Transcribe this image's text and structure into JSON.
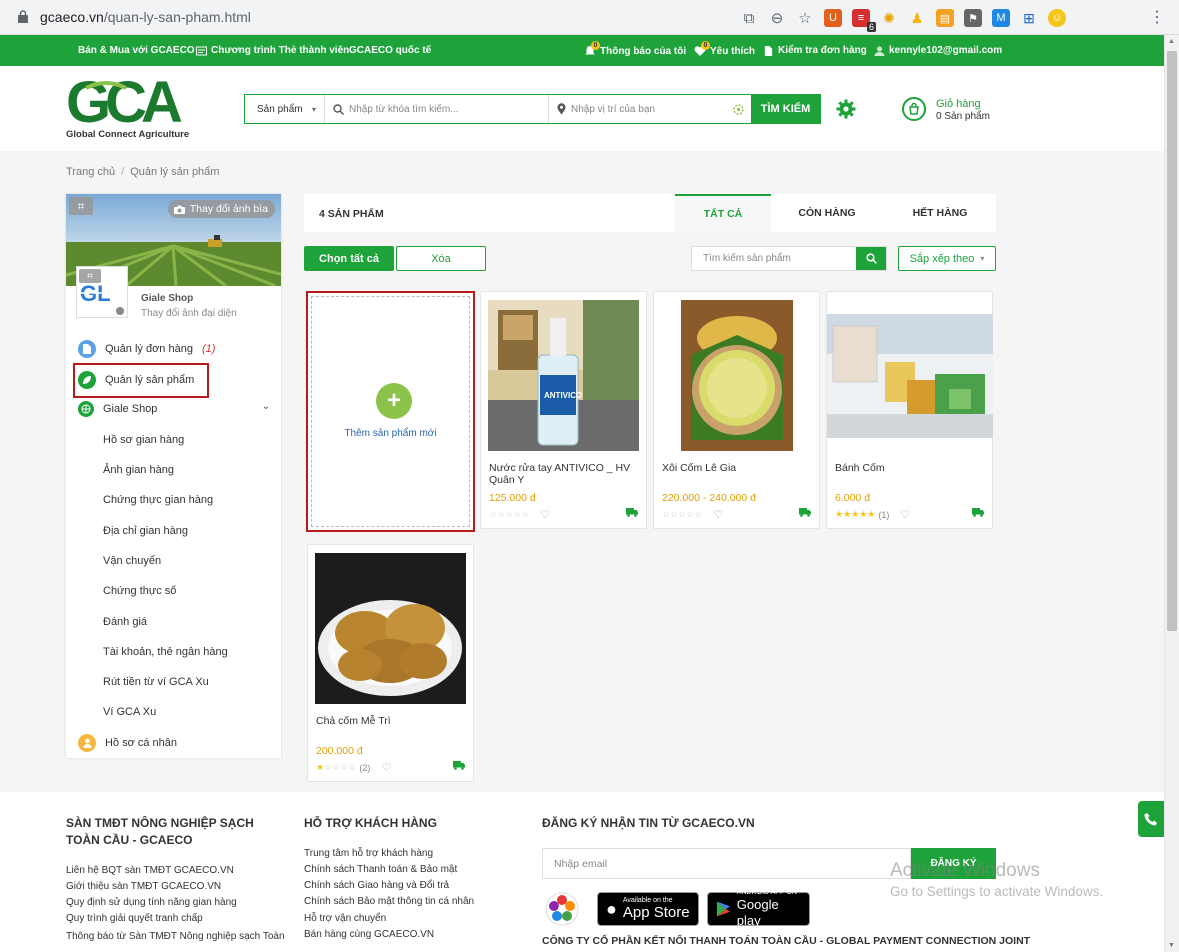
{
  "browser": {
    "domain": "gcaeco.vn",
    "path": "/quan-ly-san-pham.html",
    "ext_badge": "6"
  },
  "topnav": {
    "left": [
      "Bán & Mua với GCAECO",
      "Chương trình Thẻ thành viên",
      "GCAECO quốc tế"
    ],
    "notifications": "Thông báo của tôi",
    "notif_count": "0",
    "favorites": "Yêu thích",
    "fav_count": "0",
    "order_check": "Kiểm tra đơn hàng",
    "user_email": "kennyle102@gmail.com"
  },
  "header": {
    "logo_text": "GCA",
    "logo_tagline": "Global Connect Agriculture",
    "search_category": "Sản phẩm",
    "keyword_placeholder": "Nhập từ khóa tìm kiếm...",
    "location_placeholder": "Nhập vị trí của bạn",
    "search_button": "TÌM KIẾM",
    "cart_title": "Giỏ hàng",
    "cart_count": "0 Sản phẩm"
  },
  "breadcrumb": {
    "home": "Trang chủ",
    "current": "Quản lý sản phẩm"
  },
  "sidebar": {
    "change_cover": "Thay đổi ảnh bìa",
    "shop_name": "Giale Shop",
    "change_avatar": "Thay đổi ảnh đại diện",
    "order_mgmt": "Quản lý đơn hàng",
    "order_badge": "(1)",
    "product_mgmt": "Quản lý sản phẩm",
    "shop_menu": "Giale Shop",
    "shop_sub": [
      "Hồ sơ gian hàng",
      "Ảnh gian hàng",
      "Chứng thực gian hàng",
      "Địa chỉ gian hàng",
      "Vận chuyển",
      "Chứng thực số",
      "Đánh giá",
      "Tài khoản, thẻ ngân hàng",
      "Rút tiền từ ví GCA Xu",
      "Ví GCA Xu"
    ],
    "profile": "Hồ sơ cá nhân"
  },
  "products_header": {
    "count": "4 SẢN PHẨM",
    "tabs": [
      "TẤT CẢ",
      "CÒN HÀNG",
      "HẾT HÀNG"
    ]
  },
  "toolbar": {
    "select_all": "Chọn tất cả",
    "delete": "Xóa",
    "search_placeholder": "Tìm kiếm sản phẩm",
    "sort": "Sắp xếp theo"
  },
  "add_product": "Thêm sản phẩm mới",
  "products": [
    {
      "name": "Nước rửa tay ANTIVICO _ HV Quân Y",
      "price": "125.000 đ",
      "stars": 0,
      "reviews": ""
    },
    {
      "name": "Xôi Cốm Lê Gia",
      "price": "220.000 - 240.000 đ",
      "stars": 0,
      "reviews": ""
    },
    {
      "name": "Bánh Cốm",
      "price": "6.000 đ",
      "stars": 5,
      "reviews": "(1)"
    },
    {
      "name": "Chả cốm Mễ Trì",
      "price": "200.000 đ",
      "stars": 1,
      "reviews": "(2)"
    }
  ],
  "footer": {
    "col1_title": "SÀN TMĐT NÔNG NGHIỆP SẠCH TOÀN CẦU - GCAECO",
    "col1_links": [
      "Liên hệ BQT sàn TMĐT GCAECO.VN",
      "Giới thiệu sàn TMĐT GCAECO.VN",
      "Quy định sử dụng tính năng gian hàng",
      "Quy trình giải quyết tranh chấp",
      "Thông báo từ Sàn TMĐT Nông nghiệp sạch Toàn"
    ],
    "col2_title": "HỖ TRỢ KHÁCH HÀNG",
    "col2_links": [
      "Trung tâm hỗ trợ khách hàng",
      "Chính sách Thanh toán & Bảo mật",
      "Chính sách Giao hàng và Đổi trả",
      "Chính sách Bảo mật thông tin cá nhân",
      "Hỗ trợ vận chuyển",
      "Bán hàng cùng GCAECO.VN"
    ],
    "col3_title": "ĐĂNG KÝ NHẬN TIN TỪ GCAECO.VN",
    "email_placeholder": "Nhập email",
    "subscribe": "ĐĂNG KÝ",
    "appstore_small": "Available on the",
    "appstore_big": "App Store",
    "gplay_small": "ANDROID APP ON",
    "gplay_big": "Google play",
    "company": "CÔNG TY CỔ PHẦN KẾT NỐI THANH TOÁN TOÀN CẦU - GLOBAL PAYMENT CONNECTION JOINT"
  },
  "watermark": {
    "line1": "Activate Windows",
    "line2": "Go to Settings to activate Windows."
  },
  "colors": {
    "brand_green": "#1ea23a",
    "highlight_red": "#b71c1c",
    "price": "#e0a000"
  }
}
